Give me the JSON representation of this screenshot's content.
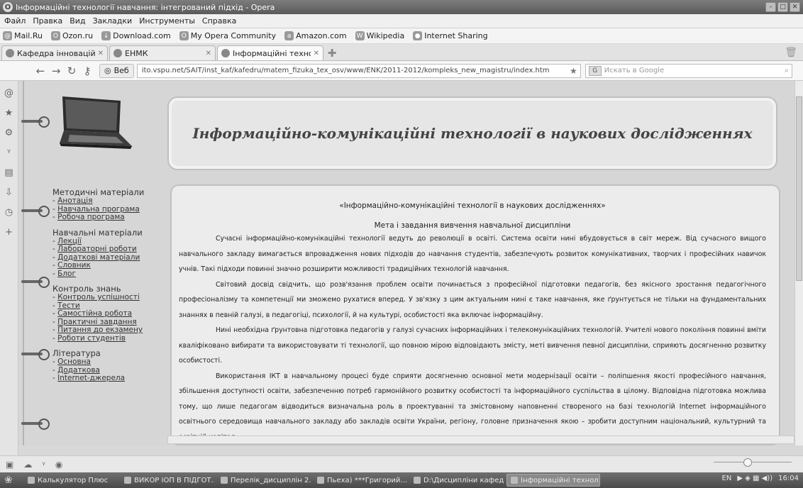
{
  "window": {
    "title": "Інформаційні технології навчання: інтегрований підхід - Opera"
  },
  "menu": [
    "Файл",
    "Правка",
    "Вид",
    "Закладки",
    "Инструменты",
    "Справка"
  ],
  "bookmarks": [
    {
      "label": "Mail.Ru",
      "icon": "mail-icon"
    },
    {
      "label": "Ozon.ru",
      "icon": "ozon-icon"
    },
    {
      "label": "Download.com",
      "icon": "download-icon"
    },
    {
      "label": "My Opera Community",
      "icon": "opera-icon"
    },
    {
      "label": "Amazon.com",
      "icon": "amazon-icon"
    },
    {
      "label": "Wikipedia",
      "icon": "wikipedia-icon"
    },
    {
      "label": "Internet Sharing",
      "icon": "sharing-icon"
    }
  ],
  "tabs": [
    {
      "label": "Кафедра інноваційних ...",
      "active": false
    },
    {
      "label": "ЕНМК",
      "active": false
    },
    {
      "label": "Інформаційні технологі...",
      "active": true
    }
  ],
  "navbar": {
    "web_label": "Веб",
    "url": "ito.vspu.net/SAIT/inst_kaf/kafedru/matem_fizuka_tex_osv/www/ENK/2011-2012/kompleks_new_magistru/index.htm",
    "search_placeholder": "Искать в Google",
    "search_engine": "G"
  },
  "page": {
    "header_title": "Інформаційно-комунікаційні технології в наукових дослідженнях",
    "sidebar": [
      {
        "section": "Методичні матеріали",
        "links": [
          "Анотація",
          "Навчальна програма",
          "Робоча програма"
        ]
      },
      {
        "section": "Навчальні матеріали",
        "links": [
          "Лекції",
          "Лабораторні роботи",
          "Додаткові матеріали",
          "Словник",
          "Блог"
        ]
      },
      {
        "section": "Контроль знань",
        "links": [
          "Контроль успішності",
          "Тести",
          "Самостійна робота",
          "Практичні завдання",
          "Питання до екзамену",
          "Роботи студентів"
        ]
      },
      {
        "section": "Література",
        "links": [
          "Основна",
          "Додаткова",
          "Internet-джерела"
        ]
      }
    ],
    "content_title": "«Інформаційно-комунікаційні технології в наукових дослідженнях»",
    "content_subtitle": "Мета і завдання вивчення навчальної дисципліни",
    "paragraphs": [
      "Сучасні інформаційно-комунікаційні технології ведуть до революції в освіті. Система освіти нині вбудовується в світ мереж. Від сучасного вищого навчального закладу вимагається впровадження нових підходів до навчання студентів, забезпечують розвиток комунікативних, творчих і професійних навичок учнів. Такі підходи повинні значно розширити можливості традиційних технологій навчання.",
      "Світовий досвід свідчить, що розв'язання проблем освіти починається з професійної підготовки педагогів, без якісного зростання педагогічного професіоналізму та компетенції ми зможемо рухатися вперед. У зв'язку з цим актуальним нині є таке навчання, яке ґрунтується не тільки на фундаментальних знаннях в певній галузі, в педагогіці, психології, й на культурі, особистості яка включає інформаційну.",
      "Нині необхідна ґрунтовна підготовка педагогів у галузі сучасних інформаційних і телекомунікаційних технологій. Учителі нового покоління повинні вміти кваліфіковано вибирати та використовувати ті технології, що повною мірою відповідають змісту, меті вивчення певної дисципліни, сприяють досягненню розвитку особистості.",
      "Використання ІКТ в навчальному процесі буде сприяти досягненню основної мети модернізації освіти – поліпшення якості професійного навчання, збільшення доступності освіти, забезпеченню потреб гармонійного розвитку особистості та інформаційного суспільства в цілому. Відповідна підготовка можлива тому, що лише педагогам відводиться визначальна роль в проектуванні та змістовному наповненні створеного на базі технологій Internet інформаційного освітнього середовища навчального закладу або закладів освіти України, регіону, головне призначення якою – зробити доступним національний, культурний та освітній капітал."
    ]
  },
  "taskbar": {
    "items": [
      {
        "label": "Калькулятор Плюс",
        "active": false
      },
      {
        "label": "ВИКОР ІОП В ПІДГОТ...",
        "active": false
      },
      {
        "label": "Перелік_дисциплін 2...",
        "active": false
      },
      {
        "label": "Пьеха) ***Григорий...",
        "active": false
      },
      {
        "label": "D:\\Дисципліни кафедри",
        "active": false
      },
      {
        "label": "Інформаційні технол...",
        "active": true
      }
    ],
    "lang": "EN",
    "clock": "16:04"
  }
}
